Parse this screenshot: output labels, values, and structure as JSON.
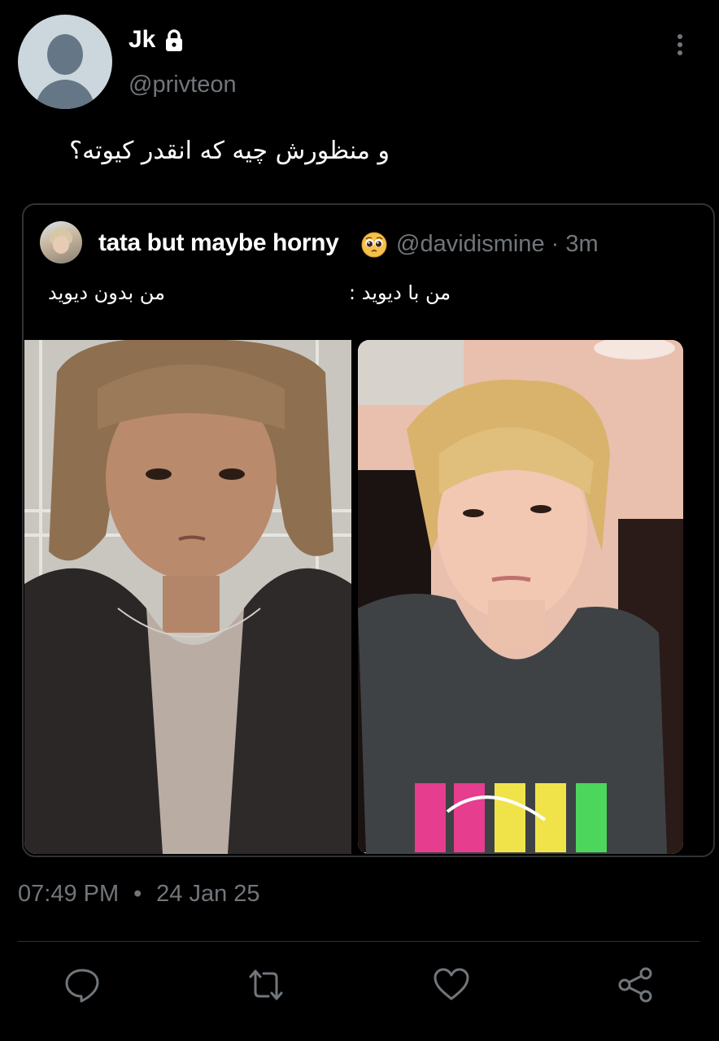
{
  "author": {
    "name": "Jk",
    "handle": "@privteon",
    "icons": {
      "locked": "lock-icon",
      "menu": "more-vertical-icon"
    }
  },
  "tweet": {
    "text": "و منظورش چیه که انقدر کیوته؟",
    "time": "07:49 PM",
    "separator": "•",
    "date": "24 Jan 25"
  },
  "quoted": {
    "name": "tata but maybe horny",
    "emoji": "pleading-face-emoji",
    "handle_time": "@davidismine · 3m",
    "caption_right": "من بدون دیوید",
    "caption_left": "من با دیوید :",
    "images": [
      {
        "description_icon": "photo-left"
      },
      {
        "description_icon": "photo-right"
      }
    ]
  },
  "actions": [
    {
      "name": "reply",
      "icon": "reply-icon"
    },
    {
      "name": "retweet",
      "icon": "retweet-icon"
    },
    {
      "name": "like",
      "icon": "heart-icon"
    },
    {
      "name": "share",
      "icon": "share-icon"
    }
  ],
  "colors": {
    "background": "#000000",
    "text": "#e7e9ea",
    "muted": "#71767b",
    "border": "#2f3336"
  }
}
